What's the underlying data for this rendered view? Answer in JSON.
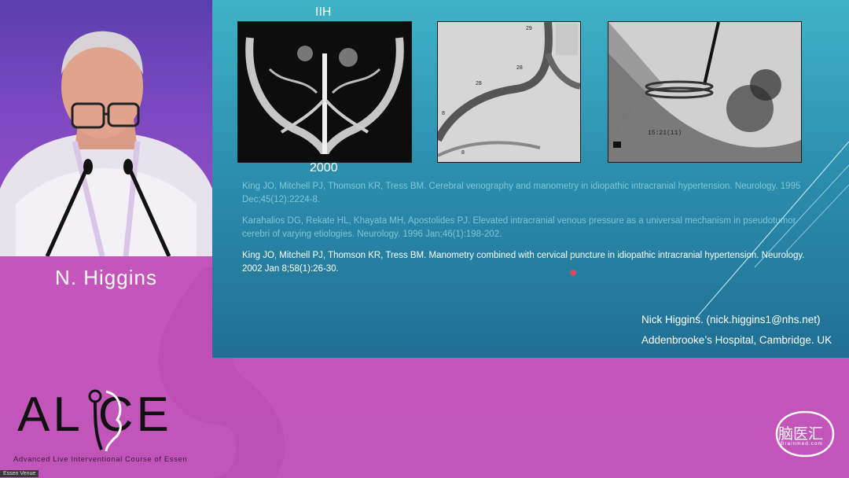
{
  "speaker": {
    "name": "N. Higgins"
  },
  "slide": {
    "label_top": "IIH",
    "label_year": "2000",
    "angio_numbers": [
      "29",
      "28",
      "28",
      "8",
      "8"
    ],
    "fluoro_text": "15:21(11)",
    "references": [
      "King JO, Mitchell PJ, Thomson KR, Tress BM. Cerebral venography and manometry in idiopathic intracranial hypertension. Neurology. 1995 Dec;45(12):2224-8.",
      "Karahalios DG, Rekate HL, Khayata MH, Apostolides PJ. Elevated intracranial venous pressure as a universal mechanism in pseudotumor cerebri of varying etiologies. Neurology. 1996 Jan;46(1):198-202.",
      "King JO, Mitchell PJ, Thomson KR, Tress BM. Manometry combined with cervical puncture in idiopathic intracranial hypertension. Neurology. 2002 Jan 8;58(1):26-30."
    ],
    "contact_name": "Nick Higgins. (nick.higgins1@nhs.net)",
    "contact_hospital": "Addenbrooke’s Hospital, Cambridge. UK"
  },
  "branding": {
    "logo": "AL CE",
    "logo_subtitle": "Advanced Live Interventional Course of Essen",
    "venue_tag": "Essen Venue",
    "watermark": "脑医汇",
    "watermark_sub": "Brainmed.com"
  },
  "colors": {
    "slide_top": "#3fb3c7",
    "slide_bottom": "#1f6f93",
    "background_magenta": "#c455bc",
    "laser": "#ff3b4c"
  }
}
